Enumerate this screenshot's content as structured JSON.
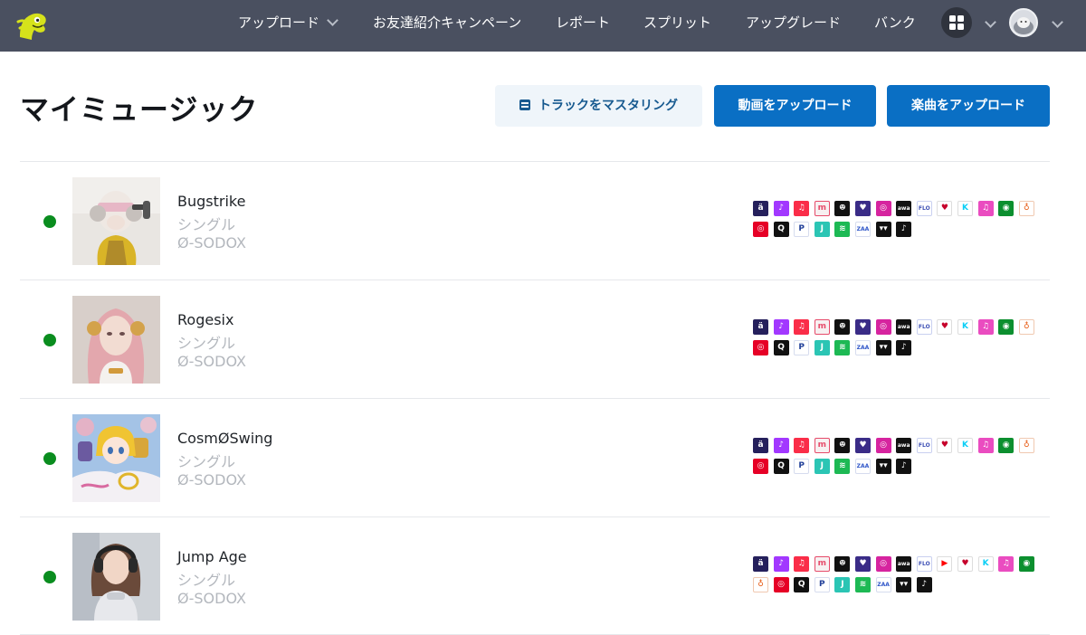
{
  "nav": {
    "items": [
      {
        "label": "アップロード",
        "has_dropdown": true
      },
      {
        "label": "お友達紹介キャンペーン",
        "has_dropdown": false
      },
      {
        "label": "レポート",
        "has_dropdown": false
      },
      {
        "label": "スプリット",
        "has_dropdown": false
      },
      {
        "label": "アップグレード",
        "has_dropdown": false
      },
      {
        "label": "バンク",
        "has_dropdown": false
      }
    ],
    "apps_icon": "grid-icon",
    "avatar_icon": "avatar"
  },
  "page": {
    "title": "マイミュージック",
    "buttons": {
      "mastering": "トラックをマスタリング",
      "upload_video": "動画をアップロード",
      "upload_music": "楽曲をアップロード"
    }
  },
  "tracks": [
    {
      "title": "Bugstrike",
      "type": "シングル",
      "artist": "Ø-SODOX",
      "status": "live",
      "status_color": "#0a8d1f",
      "platforms": [
        "amazon-music",
        "deezer",
        "apple-music",
        "melon",
        "audiomack",
        "anghami",
        "instagram",
        "awa",
        "flo",
        "iheart",
        "kkbox",
        "itunes",
        "napster",
        "boomplay",
        "netease",
        "qobuz",
        "pandora",
        "saavn",
        "spotify",
        "tidal",
        "tiktok-music",
        "tiktok"
      ]
    },
    {
      "title": "Rogesix",
      "type": "シングル",
      "artist": "Ø-SODOX",
      "status": "live",
      "status_color": "#0a8d1f",
      "platforms": [
        "amazon-music",
        "deezer",
        "apple-music",
        "melon",
        "audiomack",
        "anghami",
        "instagram",
        "awa",
        "flo",
        "iheart",
        "kkbox",
        "itunes",
        "napster",
        "boomplay",
        "netease",
        "qobuz",
        "pandora",
        "saavn",
        "spotify",
        "tidal",
        "tiktok-music",
        "tiktok"
      ]
    },
    {
      "title": "CosmØSwing",
      "type": "シングル",
      "artist": "Ø-SODOX",
      "status": "live",
      "status_color": "#0a8d1f",
      "platforms": [
        "amazon-music",
        "deezer",
        "apple-music",
        "melon",
        "audiomack",
        "anghami",
        "instagram",
        "awa",
        "flo",
        "iheart",
        "kkbox",
        "itunes",
        "napster",
        "boomplay",
        "netease",
        "qobuz",
        "pandora",
        "saavn",
        "spotify",
        "tidal",
        "tiktok-music",
        "tiktok"
      ]
    },
    {
      "title": "Jump Age",
      "type": "シングル",
      "artist": "Ø-SODOX",
      "status": "live",
      "status_color": "#0a8d1f",
      "platforms": [
        "amazon-music",
        "deezer",
        "apple-music",
        "melon",
        "audiomack",
        "anghami",
        "instagram",
        "awa",
        "flo",
        "youtube-music",
        "iheart",
        "kkbox",
        "itunes",
        "napster",
        "boomplay",
        "netease",
        "qobuz",
        "pandora",
        "saavn",
        "spotify",
        "tidal",
        "tiktok-music",
        "tiktok"
      ]
    }
  ],
  "colors": {
    "nav_bg": "#4a5060",
    "accent": "#0a6fc4",
    "status_live": "#0a8d1f"
  }
}
